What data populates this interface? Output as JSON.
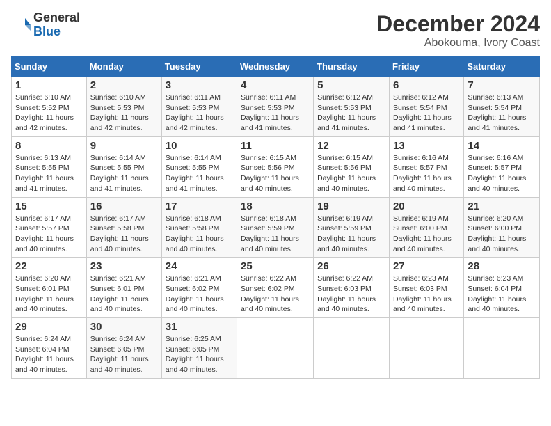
{
  "logo": {
    "general": "General",
    "blue": "Blue"
  },
  "title": "December 2024",
  "subtitle": "Abokouma, Ivory Coast",
  "days_of_week": [
    "Sunday",
    "Monday",
    "Tuesday",
    "Wednesday",
    "Thursday",
    "Friday",
    "Saturday"
  ],
  "weeks": [
    [
      {
        "day": "1",
        "sunrise": "6:10 AM",
        "sunset": "5:52 PM",
        "daylight": "11 hours and 42 minutes."
      },
      {
        "day": "2",
        "sunrise": "6:10 AM",
        "sunset": "5:53 PM",
        "daylight": "11 hours and 42 minutes."
      },
      {
        "day": "3",
        "sunrise": "6:11 AM",
        "sunset": "5:53 PM",
        "daylight": "11 hours and 42 minutes."
      },
      {
        "day": "4",
        "sunrise": "6:11 AM",
        "sunset": "5:53 PM",
        "daylight": "11 hours and 41 minutes."
      },
      {
        "day": "5",
        "sunrise": "6:12 AM",
        "sunset": "5:53 PM",
        "daylight": "11 hours and 41 minutes."
      },
      {
        "day": "6",
        "sunrise": "6:12 AM",
        "sunset": "5:54 PM",
        "daylight": "11 hours and 41 minutes."
      },
      {
        "day": "7",
        "sunrise": "6:13 AM",
        "sunset": "5:54 PM",
        "daylight": "11 hours and 41 minutes."
      }
    ],
    [
      {
        "day": "8",
        "sunrise": "6:13 AM",
        "sunset": "5:55 PM",
        "daylight": "11 hours and 41 minutes."
      },
      {
        "day": "9",
        "sunrise": "6:14 AM",
        "sunset": "5:55 PM",
        "daylight": "11 hours and 41 minutes."
      },
      {
        "day": "10",
        "sunrise": "6:14 AM",
        "sunset": "5:55 PM",
        "daylight": "11 hours and 41 minutes."
      },
      {
        "day": "11",
        "sunrise": "6:15 AM",
        "sunset": "5:56 PM",
        "daylight": "11 hours and 40 minutes."
      },
      {
        "day": "12",
        "sunrise": "6:15 AM",
        "sunset": "5:56 PM",
        "daylight": "11 hours and 40 minutes."
      },
      {
        "day": "13",
        "sunrise": "6:16 AM",
        "sunset": "5:57 PM",
        "daylight": "11 hours and 40 minutes."
      },
      {
        "day": "14",
        "sunrise": "6:16 AM",
        "sunset": "5:57 PM",
        "daylight": "11 hours and 40 minutes."
      }
    ],
    [
      {
        "day": "15",
        "sunrise": "6:17 AM",
        "sunset": "5:57 PM",
        "daylight": "11 hours and 40 minutes."
      },
      {
        "day": "16",
        "sunrise": "6:17 AM",
        "sunset": "5:58 PM",
        "daylight": "11 hours and 40 minutes."
      },
      {
        "day": "17",
        "sunrise": "6:18 AM",
        "sunset": "5:58 PM",
        "daylight": "11 hours and 40 minutes."
      },
      {
        "day": "18",
        "sunrise": "6:18 AM",
        "sunset": "5:59 PM",
        "daylight": "11 hours and 40 minutes."
      },
      {
        "day": "19",
        "sunrise": "6:19 AM",
        "sunset": "5:59 PM",
        "daylight": "11 hours and 40 minutes."
      },
      {
        "day": "20",
        "sunrise": "6:19 AM",
        "sunset": "6:00 PM",
        "daylight": "11 hours and 40 minutes."
      },
      {
        "day": "21",
        "sunrise": "6:20 AM",
        "sunset": "6:00 PM",
        "daylight": "11 hours and 40 minutes."
      }
    ],
    [
      {
        "day": "22",
        "sunrise": "6:20 AM",
        "sunset": "6:01 PM",
        "daylight": "11 hours and 40 minutes."
      },
      {
        "day": "23",
        "sunrise": "6:21 AM",
        "sunset": "6:01 PM",
        "daylight": "11 hours and 40 minutes."
      },
      {
        "day": "24",
        "sunrise": "6:21 AM",
        "sunset": "6:02 PM",
        "daylight": "11 hours and 40 minutes."
      },
      {
        "day": "25",
        "sunrise": "6:22 AM",
        "sunset": "6:02 PM",
        "daylight": "11 hours and 40 minutes."
      },
      {
        "day": "26",
        "sunrise": "6:22 AM",
        "sunset": "6:03 PM",
        "daylight": "11 hours and 40 minutes."
      },
      {
        "day": "27",
        "sunrise": "6:23 AM",
        "sunset": "6:03 PM",
        "daylight": "11 hours and 40 minutes."
      },
      {
        "day": "28",
        "sunrise": "6:23 AM",
        "sunset": "6:04 PM",
        "daylight": "11 hours and 40 minutes."
      }
    ],
    [
      {
        "day": "29",
        "sunrise": "6:24 AM",
        "sunset": "6:04 PM",
        "daylight": "11 hours and 40 minutes."
      },
      {
        "day": "30",
        "sunrise": "6:24 AM",
        "sunset": "6:05 PM",
        "daylight": "11 hours and 40 minutes."
      },
      {
        "day": "31",
        "sunrise": "6:25 AM",
        "sunset": "6:05 PM",
        "daylight": "11 hours and 40 minutes."
      },
      null,
      null,
      null,
      null
    ]
  ]
}
